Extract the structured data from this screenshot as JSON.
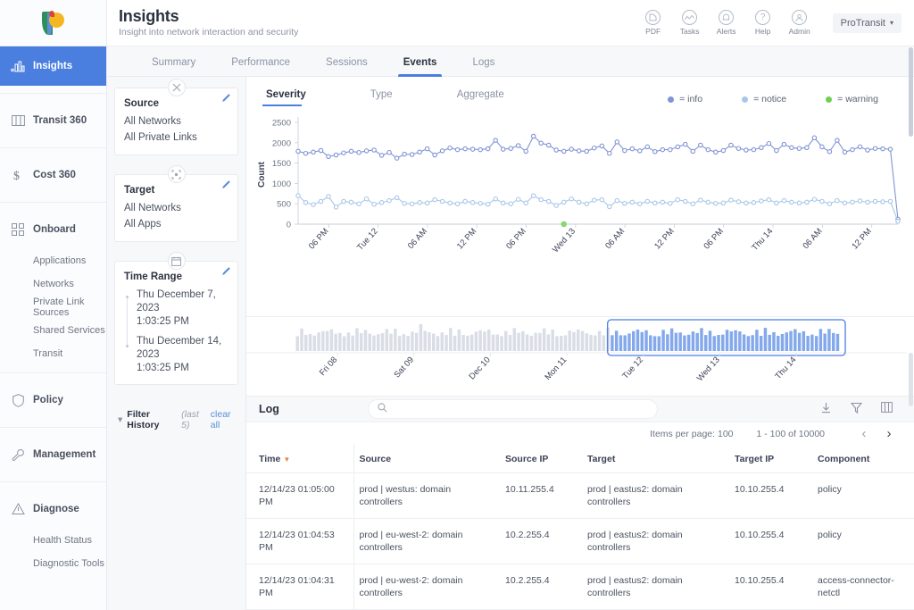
{
  "brand": {
    "name": "logo-p"
  },
  "sidebar": {
    "items": [
      {
        "label": "Insights",
        "icon": "bar-chart-icon",
        "active": true
      },
      {
        "label": "Transit 360",
        "icon": "map-icon",
        "active": false
      },
      {
        "label": "Cost 360",
        "icon": "dollar-icon",
        "active": false
      },
      {
        "label": "Onboard",
        "icon": "grid-icon",
        "active": false
      },
      {
        "label": "Policy",
        "icon": "shield-icon",
        "active": false
      },
      {
        "label": "Management",
        "icon": "wrench-icon",
        "active": false
      },
      {
        "label": "Diagnose",
        "icon": "warning-icon",
        "active": false
      }
    ],
    "onboard_sub": [
      "Applications",
      "Networks",
      "Private Link Sources",
      "Shared Services",
      "Transit"
    ],
    "diagnose_sub": [
      "Health Status",
      "Diagnostic Tools"
    ]
  },
  "header": {
    "title": "Insights",
    "subtitle": "Insight into network interaction and security",
    "actions": [
      {
        "label": "PDF",
        "icon": "pdf-icon"
      },
      {
        "label": "Tasks",
        "icon": "tasks-icon"
      },
      {
        "label": "Alerts",
        "icon": "bell-icon"
      },
      {
        "label": "Help",
        "icon": "question-icon"
      },
      {
        "label": "Admin",
        "icon": "user-icon"
      }
    ],
    "account": "ProTransit"
  },
  "tabs": [
    {
      "label": "Summary",
      "active": false
    },
    {
      "label": "Performance",
      "active": false
    },
    {
      "label": "Sessions",
      "active": false
    },
    {
      "label": "Events",
      "active": true
    },
    {
      "label": "Logs",
      "active": false
    }
  ],
  "filters": {
    "source": {
      "title": "Source",
      "icon": "source-icon",
      "rows": [
        "All Networks",
        "All Private Links"
      ]
    },
    "target": {
      "title": "Target",
      "icon": "target-icon",
      "rows": [
        "All Networks",
        "All Apps"
      ]
    },
    "time_range": {
      "title": "Time Range",
      "icon": "calendar-icon",
      "start_date": "Thu December 7, 2023",
      "start_time": "1:03:25 PM",
      "end_date": "Thu December 14, 2023",
      "end_time": "1:03:25 PM"
    },
    "history": {
      "label": "Filter History",
      "note": "(last 5)",
      "clear": "clear all"
    }
  },
  "severity_tabs": [
    {
      "label": "Severity",
      "active": true
    },
    {
      "label": "Type",
      "active": false
    },
    {
      "label": "Aggregate",
      "active": false
    }
  ],
  "chart_data": {
    "type": "line",
    "title": "",
    "xlabel": "",
    "ylabel": "Count",
    "ylim": [
      0,
      2500
    ],
    "yticks": [
      0,
      500,
      1000,
      1500,
      2000,
      2500
    ],
    "grid": false,
    "legend_position": "top-right",
    "xticks": [
      "06 PM",
      "Tue 12",
      "06 AM",
      "12 PM",
      "06 PM",
      "Wed 13",
      "06 AM",
      "12 PM",
      "06 PM",
      "Thu 14",
      "06 AM",
      "12 PM"
    ],
    "legend": [
      {
        "name": "info",
        "color": "#8094d4"
      },
      {
        "name": "notice",
        "color": "#a8c7e8"
      },
      {
        "name": "warning",
        "color": "#6fcf52"
      }
    ],
    "series": [
      {
        "name": "info",
        "color": "#8094d4",
        "values": [
          1790,
          1740,
          1770,
          1810,
          1660,
          1700,
          1750,
          1790,
          1760,
          1800,
          1820,
          1690,
          1760,
          1620,
          1720,
          1710,
          1770,
          1850,
          1700,
          1800,
          1870,
          1830,
          1850,
          1840,
          1830,
          1850,
          2060,
          1840,
          1860,
          1930,
          1790,
          2160,
          1990,
          1940,
          1820,
          1790,
          1840,
          1800,
          1790,
          1870,
          1920,
          1740,
          2020,
          1810,
          1850,
          1800,
          1900,
          1780,
          1830,
          1830,
          1900,
          1960,
          1790,
          1940,
          1830,
          1770,
          1810,
          1940,
          1860,
          1820,
          1830,
          1880,
          1980,
          1810,
          1960,
          1880,
          1860,
          1880,
          2120,
          1900,
          1780,
          2060,
          1770,
          1830,
          1900,
          1820,
          1860,
          1850,
          1840,
          120
        ]
      },
      {
        "name": "notice",
        "color": "#a8c7e8",
        "values": [
          700,
          530,
          480,
          560,
          680,
          420,
          560,
          540,
          500,
          620,
          490,
          530,
          580,
          650,
          510,
          500,
          530,
          520,
          600,
          560,
          520,
          500,
          560,
          530,
          510,
          490,
          620,
          520,
          500,
          610,
          520,
          700,
          600,
          560,
          460,
          540,
          620,
          540,
          500,
          590,
          600,
          430,
          580,
          510,
          540,
          500,
          560,
          520,
          540,
          510,
          600,
          560,
          500,
          590,
          540,
          510,
          520,
          590,
          550,
          520,
          530,
          570,
          600,
          520,
          580,
          540,
          520,
          540,
          610,
          560,
          500,
          580,
          520,
          540,
          570,
          540,
          560,
          550,
          560,
          70
        ]
      }
    ],
    "brush": {
      "type": "bar",
      "xticks": [
        "Fri 08",
        "Sat 09",
        "Dec 10",
        "Mon 11",
        "Tue 12",
        "Wed 13",
        "Thu 14"
      ],
      "selection_start_label": "Tue 12",
      "selection_end_label": "Thu 14",
      "selected_color": "#6e9ae8",
      "unselected_color": "#ccd2dd"
    }
  },
  "log": {
    "title": "Log",
    "search_placeholder": "",
    "search_value": "",
    "icons": [
      {
        "name": "download-icon"
      },
      {
        "name": "filter-icon"
      },
      {
        "name": "columns-icon"
      }
    ],
    "items_per_page_label": "Items per page: 100",
    "range_label": "1 - 100 of 10000",
    "columns": [
      "Time",
      "Source",
      "Source IP",
      "Target",
      "Target IP",
      "Component"
    ],
    "sort_column": "Time",
    "rows": [
      {
        "time": "12/14/23 01:05:00 PM",
        "source": "prod | westus: domain controllers",
        "source_ip": "10.11.255.4",
        "target": "prod | eastus2: domain controllers",
        "target_ip": "10.10.255.4",
        "component": "policy"
      },
      {
        "time": "12/14/23 01:04:53 PM",
        "source": "prod | eu-west-2: domain controllers",
        "source_ip": "10.2.255.4",
        "target": "prod | eastus2: domain controllers",
        "target_ip": "10.10.255.4",
        "component": "policy"
      },
      {
        "time": "12/14/23 01:04:31 PM",
        "source": "prod | eu-west-2: domain controllers",
        "source_ip": "10.2.255.4",
        "target": "prod | eastus2: domain controllers",
        "target_ip": "10.10.255.4",
        "component": "access-connector-netctl"
      }
    ]
  },
  "colors": {
    "accent": "#4a7fe0",
    "sidebar_active": "#4a7fe0",
    "sort_caret": "#e08a3c"
  }
}
